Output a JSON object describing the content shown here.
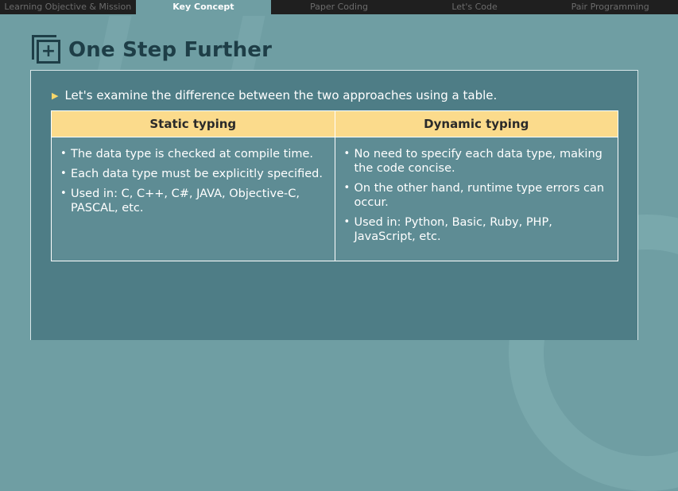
{
  "tabs": [
    {
      "label": "Learning Objective & Mission",
      "active": false
    },
    {
      "label": "Key Concept",
      "active": true
    },
    {
      "label": "Paper Coding",
      "active": false
    },
    {
      "label": "Let's Code",
      "active": false
    },
    {
      "label": "Pair Programming",
      "active": false
    }
  ],
  "header": {
    "icon": "plus-box-icon",
    "title": "One Step Further"
  },
  "panel": {
    "intro": "Let's examine the difference between the two approaches using a table.",
    "table": {
      "headers": [
        "Static typing",
        "Dynamic typing"
      ],
      "static_items": [
        "The data type is checked at compile time.",
        "Each data type must be explicitly specified.",
        "Used in: C, C++, C#, JAVA, Objective-C, PASCAL, etc."
      ],
      "dynamic_items": [
        "No need to specify each data type, making the code concise.",
        "On the other hand, runtime type errors can occur.",
        "Used in: Python, Basic, Ruby, PHP, JavaScript, etc."
      ]
    }
  },
  "colors": {
    "background": "#6f9ea3",
    "panel": "#4e7d86",
    "header_fill": "#fbdb8c",
    "title": "#1e3e47",
    "tabbar": "#1f1f1f"
  }
}
